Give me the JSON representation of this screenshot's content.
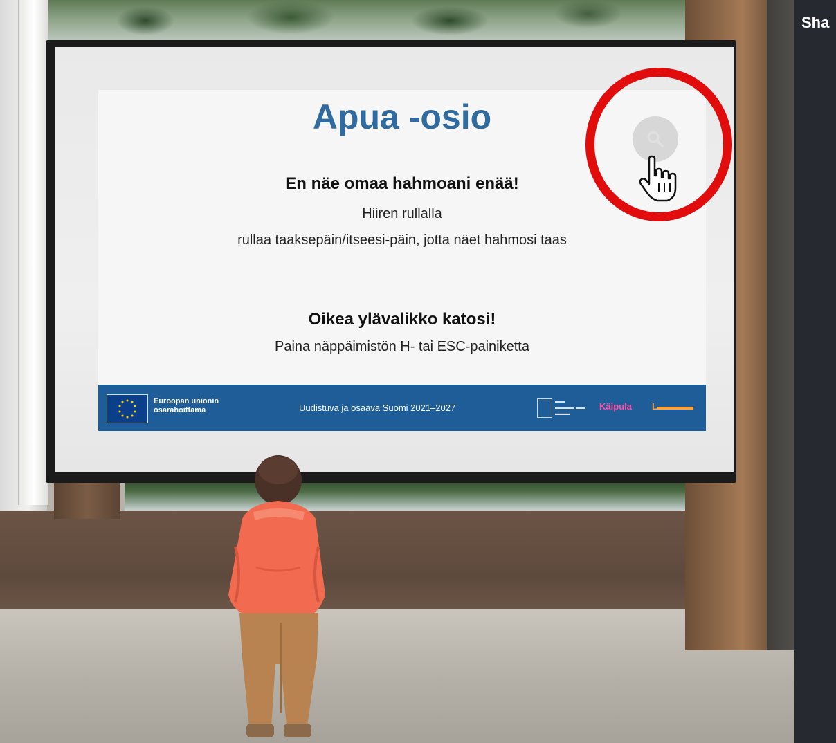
{
  "side_panel": {
    "title": "Sha"
  },
  "slide": {
    "title": "Apua -osio",
    "section1_heading": "En näe omaa hahmoani enää!",
    "section1_line1": "Hiiren rullalla",
    "section1_line2": "rullaa taaksepäin/itseesi-päin, jotta näet hahmosi taas",
    "section2_heading": "Oikea ylävalikko katosi!",
    "section2_line1": "Paina näppäimistön H- tai ESC-painiketta"
  },
  "banner": {
    "eu_line1": "Euroopan unionin",
    "eu_line2": "osarahoittama",
    "center_text": "Uudistuva ja osaava Suomi 2021–2027",
    "kaipula": "Käipula",
    "colors": {
      "background": "#1f5d98",
      "kaipula": "#ff4fa7"
    }
  },
  "icons": {
    "zoom": "zoom-icon",
    "cursor": "hand-pointer-icon",
    "highlight": "red-highlight-circle"
  },
  "colors": {
    "title": "#2f6aa0",
    "highlight_ring": "#e10c0c",
    "jacket": "#f26a4f"
  }
}
